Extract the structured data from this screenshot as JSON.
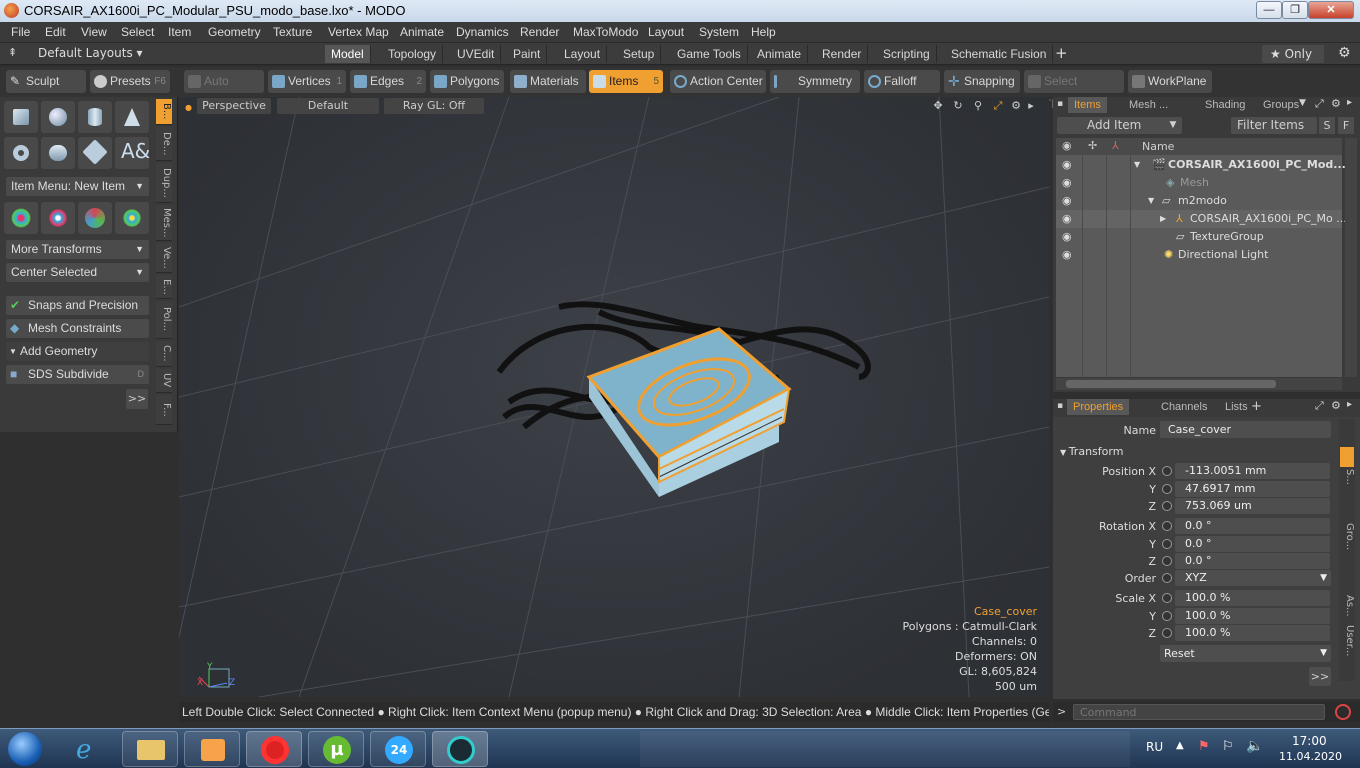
{
  "window": {
    "title": "CORSAIR_AX1600i_PC_Modular_PSU_modo_base.lxo* - MODO",
    "min": "—",
    "max": "❐",
    "close": "✕"
  },
  "menu": [
    "File",
    "Edit",
    "View",
    "Select",
    "Item",
    "Geometry",
    "Texture",
    "Vertex Map",
    "Animate",
    "Dynamics",
    "Render",
    "MaxToModo",
    "Layout",
    "System",
    "Help"
  ],
  "layoutbar": {
    "layouts_label": "Default Layouts ▾",
    "tabs": [
      "Model",
      "Topology",
      "UVEdit",
      "Paint",
      "Layout",
      "Setup",
      "Game Tools",
      "Animate",
      "Render",
      "Scripting",
      "Schematic Fusion"
    ],
    "add": "+",
    "only": "★  Only",
    "gear": "⚙"
  },
  "toolbar": {
    "sculpt": "Sculpt",
    "presets": "Presets",
    "presets_key": "F6",
    "auto_select": "Auto Select",
    "vertices": "Vertices",
    "vertices_key": "1",
    "edges": "Edges",
    "edges_key": "2",
    "polygons": "Polygons",
    "materials": "Materials",
    "items": "Items",
    "items_key": "5",
    "action_center": "Action Center",
    "symmetry": "Symmetry",
    "falloff": "Falloff",
    "snapping": "Snapping",
    "select_through": "Select Through",
    "workplane": "WorkPlane"
  },
  "leftpanel": {
    "item_menu": "Item Menu: New Item",
    "more_transforms": "More Transforms",
    "center_selected": "Center Selected",
    "snaps": "Snaps and Precision",
    "mesh_constraints": "Mesh Constraints",
    "add_geometry": "Add Geometry",
    "sds_subdivide": "SDS Subdivide",
    "sds_key": "D",
    "more": ">>",
    "vtabs": [
      "B...",
      "De...",
      "Dup...",
      "Mes...",
      "Ve...",
      "E...",
      "Pol...",
      "C...",
      "UV",
      "F..."
    ]
  },
  "viewport": {
    "view": "Perspective",
    "shading": "Default",
    "raygl": "Ray GL: Off",
    "info": {
      "selected": "Case_cover",
      "polygons": "Polygons : Catmull-Clark",
      "channels": "Channels: 0",
      "deformers": "Deformers: ON",
      "gl": "GL: 8,605,824",
      "scale": "500 um"
    }
  },
  "items_panel": {
    "tabs": [
      "Items",
      "Mesh ...",
      "Shading",
      "Groups"
    ],
    "add_item": "Add Item",
    "filter": "Filter Items",
    "s": "S",
    "f": "F",
    "name_col": "Name",
    "rows": [
      {
        "label": "CORSAIR_AX1600i_PC_Mod..."
      },
      {
        "label": "Mesh"
      },
      {
        "label": "m2modo"
      },
      {
        "label": "CORSAIR_AX1600i_PC_Mo ..."
      },
      {
        "label": "TextureGroup"
      },
      {
        "label": "Directional Light"
      }
    ]
  },
  "properties": {
    "tabs": [
      "Properties",
      "Channels",
      "Lists"
    ],
    "add": "+",
    "name_label": "Name",
    "name_value": "Case_cover",
    "transform": "Transform",
    "position_x_label": "Position X",
    "position_x": "-113.0051 mm",
    "position_y": "47.6917 mm",
    "position_z": "753.069 um",
    "rotation_x_label": "Rotation X",
    "rotation_x": "0.0 °",
    "rotation_y": "0.0 °",
    "rotation_z": "0.0 °",
    "order_label": "Order",
    "order": "XYZ",
    "scale_x_label": "Scale X",
    "scale_x": "100.0 %",
    "scale_y": "100.0 %",
    "scale_z": "100.0 %",
    "y": "Y",
    "z": "Z",
    "reset": "Reset",
    "more": ">>",
    "side_tabs": [
      "S...",
      "Gro...",
      "As...",
      "User..."
    ]
  },
  "status": "Left Double Click: Select Connected ● Right Click: Item Context Menu (popup menu) ● Right Click and Drag: 3D Selection: Area ● Middle Click: Item Properties (General) (popov...",
  "command": {
    "prompt": ">",
    "placeholder": "Command"
  },
  "taskbar": {
    "lang": "RU",
    "time": "17:00",
    "date": "11.04.2020"
  }
}
